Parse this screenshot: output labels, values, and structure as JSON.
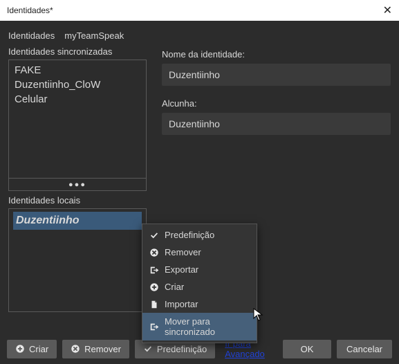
{
  "window": {
    "title": "Identidades*"
  },
  "tabs": {
    "identities": "Identidades",
    "myTeamSpeak": "myTeamSpeak"
  },
  "left": {
    "sync_label": "Identidades sincronizadas",
    "sync_items": [
      "FAKE",
      "Duzentiinho_CloW",
      "Celular"
    ],
    "more": "●●●",
    "local_label": "Identidades locais",
    "local_items": [
      "Duzentiinho"
    ]
  },
  "right": {
    "name_label": "Nome da identidade:",
    "name_value": "Duzentiinho",
    "nick_label": "Alcunha:",
    "nick_value": "Duzentiinho"
  },
  "context_menu": {
    "predef": "Predefinição",
    "remove": "Remover",
    "export": "Exportar",
    "create": "Criar",
    "import": "Importar",
    "move_sync": "Mover para sincronizado"
  },
  "footer": {
    "create": "Criar",
    "remove": "Remover",
    "predef": "Predefinição",
    "advanced": "Ir para Avançado",
    "ok": "OK",
    "cancel": "Cancelar"
  }
}
